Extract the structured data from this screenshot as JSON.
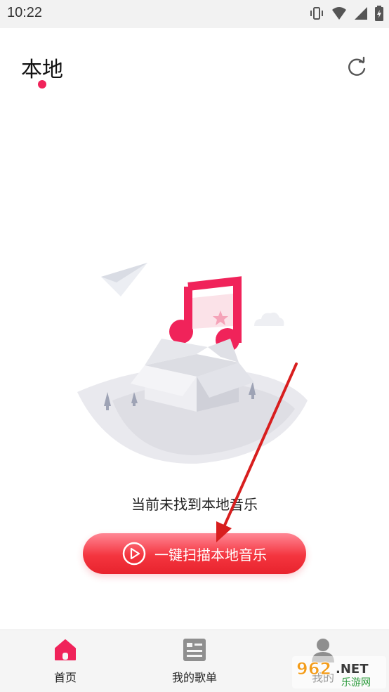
{
  "status_bar": {
    "time": "10:22"
  },
  "header": {
    "title": "本地",
    "refresh_icon": "refresh-icon"
  },
  "empty_state": {
    "message": "当前未找到本地音乐"
  },
  "scan_button": {
    "label": "一键扫描本地音乐",
    "icon": "play-circle-icon"
  },
  "bottom_nav": {
    "items": [
      {
        "label": "首页",
        "icon": "home-icon",
        "active": true
      },
      {
        "label": "我的歌单",
        "icon": "playlist-icon",
        "active": false
      },
      {
        "label": "我的",
        "icon": "person-icon",
        "active": false
      }
    ]
  },
  "watermark": {
    "text": "962.NET",
    "subtext": "乐游网"
  },
  "colors": {
    "accent": "#f0235a",
    "button_top": "#ff8694",
    "button_bottom": "#e8232d",
    "arrow": "#d81e1e"
  }
}
